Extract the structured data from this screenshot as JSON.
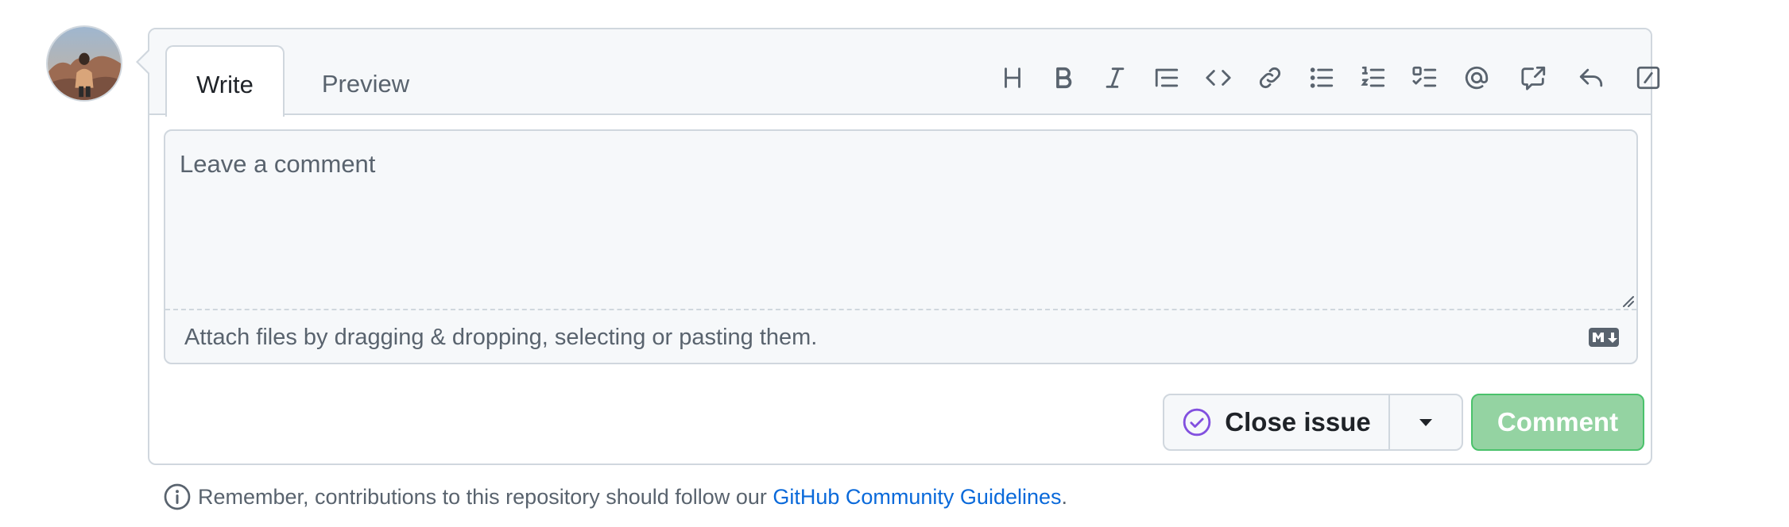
{
  "tabs": {
    "write": "Write",
    "preview": "Preview"
  },
  "toolbar": {
    "items": [
      "heading-icon",
      "bold-icon",
      "italic-icon",
      "quote-icon",
      "code-icon",
      "link-icon",
      "unordered-list-icon",
      "ordered-list-icon",
      "task-list-icon",
      "mention-icon",
      "cross-reference-icon",
      "saved-reply-icon",
      "slash-command-icon"
    ]
  },
  "editor": {
    "placeholder": "Leave a comment",
    "value": "",
    "attach_text": "Attach files by dragging & dropping, selecting or pasting them."
  },
  "actions": {
    "close_issue_label": "Close issue",
    "comment_label": "Comment"
  },
  "footer": {
    "text": "Remember, contributions to this repository should follow our",
    "link_text": "GitHub Community Guidelines",
    "suffix": "."
  },
  "colors": {
    "border": "#d0d7de",
    "header_bg": "#f6f8fa",
    "muted_text": "#59636e",
    "link": "#0969da",
    "comment_button_disabled": "#94d3a2",
    "close_issue_icon": "#8250df"
  }
}
